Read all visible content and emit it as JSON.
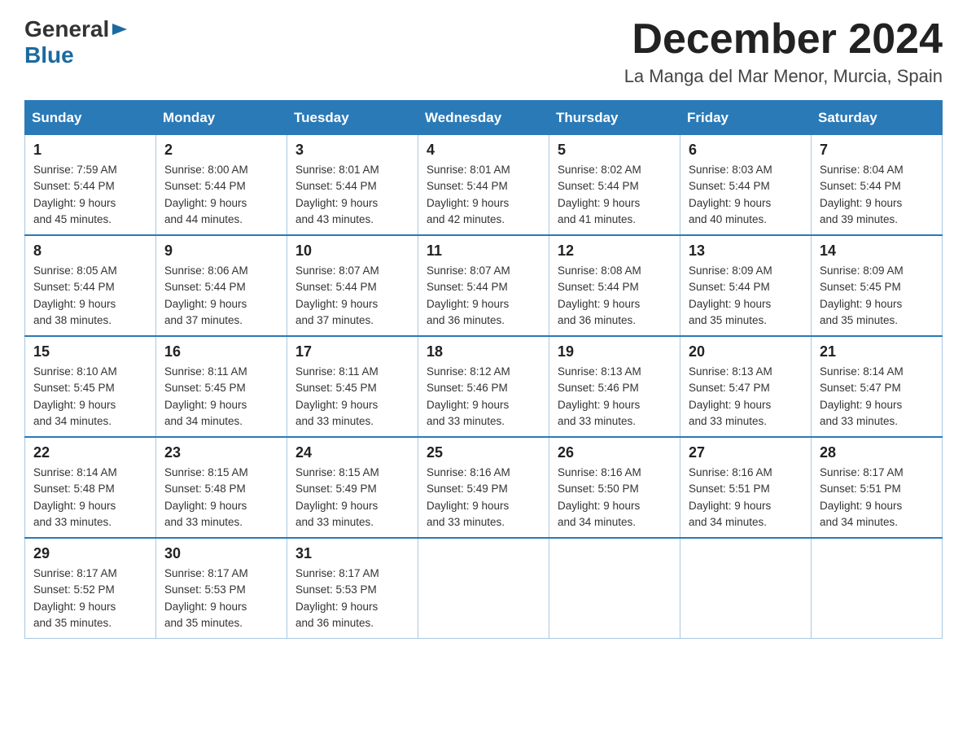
{
  "logo": {
    "general": "General",
    "blue": "Blue",
    "arrow": "▶"
  },
  "title": "December 2024",
  "subtitle": "La Manga del Mar Menor, Murcia, Spain",
  "days_of_week": [
    "Sunday",
    "Monday",
    "Tuesday",
    "Wednesday",
    "Thursday",
    "Friday",
    "Saturday"
  ],
  "weeks": [
    [
      {
        "day": "1",
        "sunrise": "7:59 AM",
        "sunset": "5:44 PM",
        "daylight": "9 hours and 45 minutes."
      },
      {
        "day": "2",
        "sunrise": "8:00 AM",
        "sunset": "5:44 PM",
        "daylight": "9 hours and 44 minutes."
      },
      {
        "day": "3",
        "sunrise": "8:01 AM",
        "sunset": "5:44 PM",
        "daylight": "9 hours and 43 minutes."
      },
      {
        "day": "4",
        "sunrise": "8:01 AM",
        "sunset": "5:44 PM",
        "daylight": "9 hours and 42 minutes."
      },
      {
        "day": "5",
        "sunrise": "8:02 AM",
        "sunset": "5:44 PM",
        "daylight": "9 hours and 41 minutes."
      },
      {
        "day": "6",
        "sunrise": "8:03 AM",
        "sunset": "5:44 PM",
        "daylight": "9 hours and 40 minutes."
      },
      {
        "day": "7",
        "sunrise": "8:04 AM",
        "sunset": "5:44 PM",
        "daylight": "9 hours and 39 minutes."
      }
    ],
    [
      {
        "day": "8",
        "sunrise": "8:05 AM",
        "sunset": "5:44 PM",
        "daylight": "9 hours and 38 minutes."
      },
      {
        "day": "9",
        "sunrise": "8:06 AM",
        "sunset": "5:44 PM",
        "daylight": "9 hours and 37 minutes."
      },
      {
        "day": "10",
        "sunrise": "8:07 AM",
        "sunset": "5:44 PM",
        "daylight": "9 hours and 37 minutes."
      },
      {
        "day": "11",
        "sunrise": "8:07 AM",
        "sunset": "5:44 PM",
        "daylight": "9 hours and 36 minutes."
      },
      {
        "day": "12",
        "sunrise": "8:08 AM",
        "sunset": "5:44 PM",
        "daylight": "9 hours and 36 minutes."
      },
      {
        "day": "13",
        "sunrise": "8:09 AM",
        "sunset": "5:44 PM",
        "daylight": "9 hours and 35 minutes."
      },
      {
        "day": "14",
        "sunrise": "8:09 AM",
        "sunset": "5:45 PM",
        "daylight": "9 hours and 35 minutes."
      }
    ],
    [
      {
        "day": "15",
        "sunrise": "8:10 AM",
        "sunset": "5:45 PM",
        "daylight": "9 hours and 34 minutes."
      },
      {
        "day": "16",
        "sunrise": "8:11 AM",
        "sunset": "5:45 PM",
        "daylight": "9 hours and 34 minutes."
      },
      {
        "day": "17",
        "sunrise": "8:11 AM",
        "sunset": "5:45 PM",
        "daylight": "9 hours and 33 minutes."
      },
      {
        "day": "18",
        "sunrise": "8:12 AM",
        "sunset": "5:46 PM",
        "daylight": "9 hours and 33 minutes."
      },
      {
        "day": "19",
        "sunrise": "8:13 AM",
        "sunset": "5:46 PM",
        "daylight": "9 hours and 33 minutes."
      },
      {
        "day": "20",
        "sunrise": "8:13 AM",
        "sunset": "5:47 PM",
        "daylight": "9 hours and 33 minutes."
      },
      {
        "day": "21",
        "sunrise": "8:14 AM",
        "sunset": "5:47 PM",
        "daylight": "9 hours and 33 minutes."
      }
    ],
    [
      {
        "day": "22",
        "sunrise": "8:14 AM",
        "sunset": "5:48 PM",
        "daylight": "9 hours and 33 minutes."
      },
      {
        "day": "23",
        "sunrise": "8:15 AM",
        "sunset": "5:48 PM",
        "daylight": "9 hours and 33 minutes."
      },
      {
        "day": "24",
        "sunrise": "8:15 AM",
        "sunset": "5:49 PM",
        "daylight": "9 hours and 33 minutes."
      },
      {
        "day": "25",
        "sunrise": "8:16 AM",
        "sunset": "5:49 PM",
        "daylight": "9 hours and 33 minutes."
      },
      {
        "day": "26",
        "sunrise": "8:16 AM",
        "sunset": "5:50 PM",
        "daylight": "9 hours and 34 minutes."
      },
      {
        "day": "27",
        "sunrise": "8:16 AM",
        "sunset": "5:51 PM",
        "daylight": "9 hours and 34 minutes."
      },
      {
        "day": "28",
        "sunrise": "8:17 AM",
        "sunset": "5:51 PM",
        "daylight": "9 hours and 34 minutes."
      }
    ],
    [
      {
        "day": "29",
        "sunrise": "8:17 AM",
        "sunset": "5:52 PM",
        "daylight": "9 hours and 35 minutes."
      },
      {
        "day": "30",
        "sunrise": "8:17 AM",
        "sunset": "5:53 PM",
        "daylight": "9 hours and 35 minutes."
      },
      {
        "day": "31",
        "sunrise": "8:17 AM",
        "sunset": "5:53 PM",
        "daylight": "9 hours and 36 minutes."
      },
      null,
      null,
      null,
      null
    ]
  ],
  "labels": {
    "sunrise": "Sunrise:",
    "sunset": "Sunset:",
    "daylight": "Daylight:"
  }
}
